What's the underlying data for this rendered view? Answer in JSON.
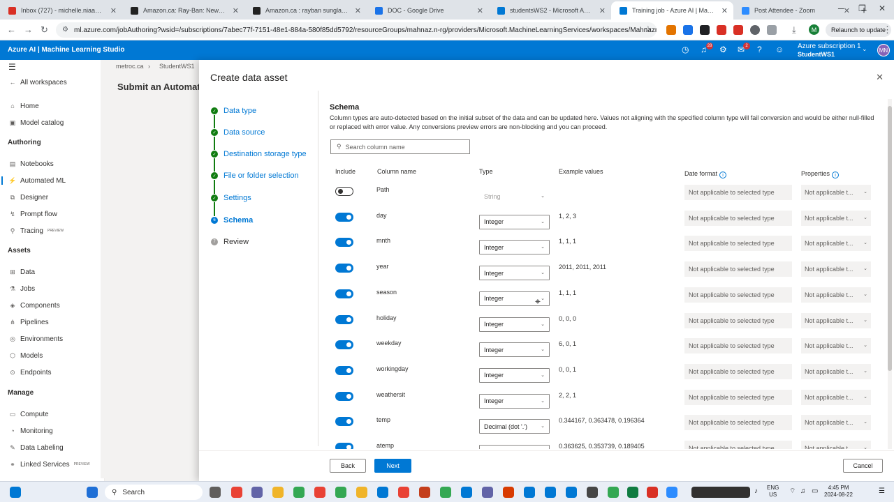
{
  "browser": {
    "tabs": [
      {
        "title": "Inbox (727) - michelle.niaa@gm",
        "color": "#d93025",
        "active": false
      },
      {
        "title": "Amazon.ca: Ray-Ban: New Arriv",
        "color": "#222222",
        "active": false
      },
      {
        "title": "Amazon.ca : rayban sunglasses",
        "color": "#222222",
        "active": false
      },
      {
        "title": "DOC - Google Drive",
        "color": "#1a73e8",
        "active": false
      },
      {
        "title": "studentsWS2 - Microsoft Azure",
        "color": "#0078d4",
        "active": false
      },
      {
        "title": "Training job - Azure AI | Machi",
        "color": "#0078d4",
        "active": true
      },
      {
        "title": "Post Attendee - Zoom",
        "color": "#2d8cff",
        "active": false
      }
    ],
    "url": "ml.azure.com/jobAuthoring?wsid=/subscriptions/7abec77f-7151-48e1-884a-580f85dd5792/resourceGroups/mahnaz.n-rg/providers/Microsoft.MachineLearningServices/workspaces/Mahnaznewwo...",
    "relaunch_label": "Relaunch to update",
    "profile_letter": "M"
  },
  "azure_header": {
    "brand": "Azure AI | Machine Learning Studio",
    "notif_count": "28",
    "feedback_count": "2",
    "subscription": "Azure subscription 1",
    "workspace": "StudentWS1",
    "user_initials": "MN"
  },
  "leftnav": {
    "all_workspaces": "All workspaces",
    "home": "Home",
    "model_catalog": "Model catalog",
    "authoring": "Authoring",
    "notebooks": "Notebooks",
    "automated_ml": "Automated ML",
    "designer": "Designer",
    "prompt_flow": "Prompt flow",
    "tracing": "Tracing",
    "preview_badge": "PREVIEW",
    "assets": "Assets",
    "data": "Data",
    "jobs": "Jobs",
    "components": "Components",
    "pipelines": "Pipelines",
    "environments": "Environments",
    "models": "Models",
    "endpoints": "Endpoints",
    "manage": "Manage",
    "compute": "Compute",
    "monitoring": "Monitoring",
    "data_labeling": "Data Labeling",
    "linked_services": "Linked Services"
  },
  "background": {
    "crumb1": "metroc.ca",
    "crumb2": "StudentWS1",
    "title": "Submit an Automated"
  },
  "panel": {
    "title": "Create data asset",
    "steps": [
      {
        "label": "Data type",
        "state": "done"
      },
      {
        "label": "Data source",
        "state": "done"
      },
      {
        "label": "Destination storage type",
        "state": "done"
      },
      {
        "label": "File or folder selection",
        "state": "done"
      },
      {
        "label": "Settings",
        "state": "done"
      },
      {
        "label": "Schema",
        "state": "current",
        "num": "6"
      },
      {
        "label": "Review",
        "state": "todo",
        "num": "7"
      }
    ],
    "schema_title": "Schema",
    "schema_desc": "Column types are auto-detected based on the initial subset of the data and can be updated here. Values not aligning with the specified column type will fail conversion and would be either null-filled or replaced with error value. Any conversions preview errors are non-blocking and you can proceed.",
    "search_placeholder": "Search column name",
    "headers": {
      "include": "Include",
      "column_name": "Column name",
      "type": "Type",
      "example_values": "Example values",
      "date_format": "Date format",
      "properties": "Properties"
    },
    "rows": [
      {
        "name": "Path",
        "include": false,
        "type": "String",
        "examples": "",
        "date_format": "Not applicable to selected type",
        "properties": "Not applicable t..."
      },
      {
        "name": "day",
        "include": true,
        "type": "Integer",
        "examples": "1, 2, 3",
        "date_format": "Not applicable to selected type",
        "properties": "Not applicable t..."
      },
      {
        "name": "mnth",
        "include": true,
        "type": "Integer",
        "examples": "1, 1, 1",
        "date_format": "Not applicable to selected type",
        "properties": "Not applicable t..."
      },
      {
        "name": "year",
        "include": true,
        "type": "Integer",
        "examples": "2011, 2011, 2011",
        "date_format": "Not applicable to selected type",
        "properties": "Not applicable t..."
      },
      {
        "name": "season",
        "include": true,
        "type": "Integer",
        "examples": "1, 1, 1",
        "date_format": "Not applicable to selected type",
        "properties": "Not applicable t..."
      },
      {
        "name": "holiday",
        "include": true,
        "type": "Integer",
        "examples": "0, 0, 0",
        "date_format": "Not applicable to selected type",
        "properties": "Not applicable t..."
      },
      {
        "name": "weekday",
        "include": true,
        "type": "Integer",
        "examples": "6, 0, 1",
        "date_format": "Not applicable to selected type",
        "properties": "Not applicable t..."
      },
      {
        "name": "workingday",
        "include": true,
        "type": "Integer",
        "examples": "0, 0, 1",
        "date_format": "Not applicable to selected type",
        "properties": "Not applicable t..."
      },
      {
        "name": "weathersit",
        "include": true,
        "type": "Integer",
        "examples": "2, 2, 1",
        "date_format": "Not applicable to selected type",
        "properties": "Not applicable t..."
      },
      {
        "name": "temp",
        "include": true,
        "type": "Decimal (dot '.')",
        "examples": "0.344167, 0.363478, 0.196364",
        "date_format": "Not applicable to selected type",
        "properties": "Not applicable t..."
      },
      {
        "name": "atemp",
        "include": true,
        "type": "Decimal (dot '.')",
        "examples": "0.363625, 0.353739, 0.189405",
        "date_format": "Not applicable to selected type",
        "properties": "Not applicable t..."
      }
    ],
    "back_label": "Back",
    "next_label": "Next",
    "cancel_label": "Cancel"
  },
  "taskbar": {
    "search_label": "Search",
    "lang": "ENG",
    "region": "US",
    "time": "4:45 PM",
    "date": "2024-08-22"
  }
}
